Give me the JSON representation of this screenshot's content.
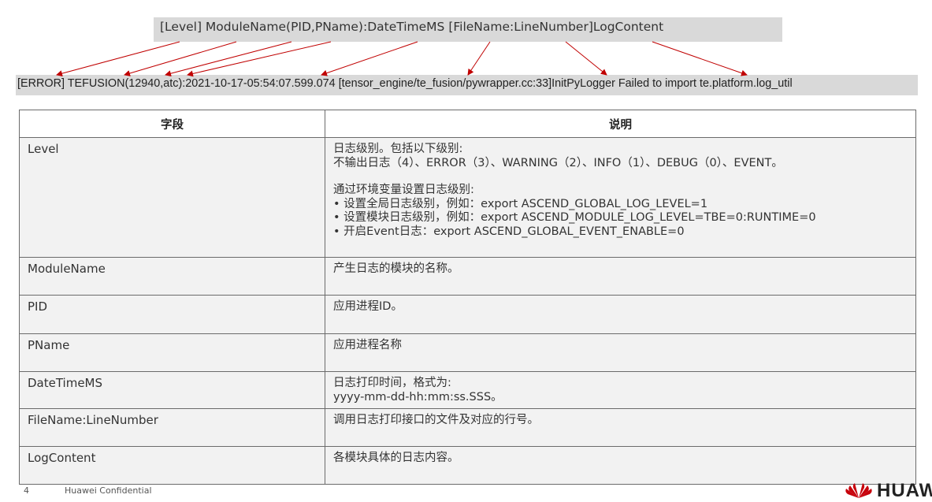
{
  "format_line": "[Level] ModuleName(PID,PName):DateTimeMS [FileName:LineNumber]LogContent",
  "sample_line": "[ERROR] TEFUSION(12940,atc):2021-10-17-05:54:07.599.074 [tensor_engine/te_fusion/pywrapper.cc:33]InitPyLogger Failed to import te.platform.log_util",
  "arrow_color": "#c00000",
  "table": {
    "headers": [
      "字段",
      "说明"
    ],
    "rows": [
      {
        "field": "Level",
        "lines": [
          "日志级别。包括以下级别:",
          "不输出日志（4）、ERROR（3）、WARNING（2）、INFO（1）、DEBUG（0）、EVENT。",
          "",
          "通过环境变量设置日志级别:",
          "设置全局日志级别，例如：export ASCEND_GLOBAL_LOG_LEVEL=1",
          "设置模块日志级别，例如：export ASCEND_MODULE_LOG_LEVEL=TBE=0:RUNTIME=0",
          "开启Event日志：export ASCEND_GLOBAL_EVENT_ENABLE=0"
        ]
      },
      {
        "field": "ModuleName",
        "lines": [
          "产生日志的模块的名称。"
        ]
      },
      {
        "field": "PID",
        "lines": [
          "应用进程ID。"
        ]
      },
      {
        "field": "PName",
        "lines": [
          "应用进程名称"
        ]
      },
      {
        "field": "DateTimeMS",
        "lines": [
          "日志打印时间，格式为:",
          "yyyy-mm-dd-hh:mm:ss.SSS。"
        ]
      },
      {
        "field": "FileName:LineNumber",
        "lines": [
          "调用日志打印接口的文件及对应的行号。"
        ]
      },
      {
        "field": "LogContent",
        "lines": [
          "各模块具体的日志内容。"
        ]
      }
    ]
  },
  "footer": {
    "page_number": "4",
    "text": "Huawei Confidential",
    "logo_text": "HUAWEI"
  },
  "logo_color": "#c7000b"
}
